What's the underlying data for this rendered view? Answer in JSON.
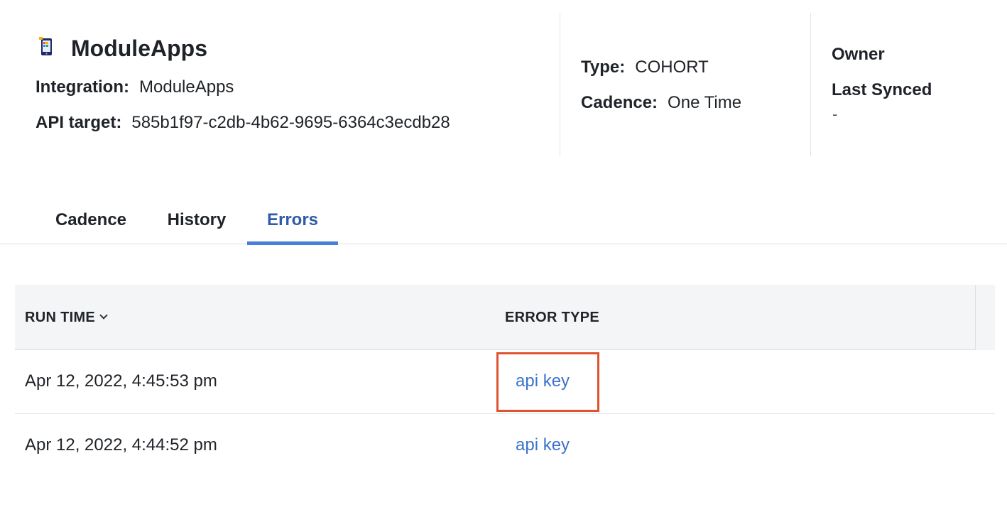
{
  "header": {
    "app_name": "ModuleApps",
    "app_icon": "phone-app-icon",
    "integration_label": "Integration:",
    "integration_value": "ModuleApps",
    "api_target_label": "API target:",
    "api_target_value": "585b1f97-c2db-4b62-9695-6364c3ecdb28",
    "type_label": "Type:",
    "type_value": "COHORT",
    "cadence_label": "Cadence:",
    "cadence_value": "One Time",
    "owner_label": "Owner",
    "last_synced_label": "Last Synced",
    "last_synced_value": "-"
  },
  "tabs": [
    {
      "label": "Cadence",
      "active": false
    },
    {
      "label": "History",
      "active": false
    },
    {
      "label": "Errors",
      "active": true
    }
  ],
  "table": {
    "columns": [
      {
        "label": "RUN TIME",
        "sort_icon": "chevron-down-icon"
      },
      {
        "label": "ERROR TYPE"
      }
    ],
    "rows": [
      {
        "run_time": "Apr 12, 2022, 4:45:53 pm",
        "error_type": "api key",
        "highlighted": true
      },
      {
        "run_time": "Apr 12, 2022, 4:44:52 pm",
        "error_type": "api key",
        "highlighted": false
      }
    ]
  },
  "colors": {
    "active_tab_text": "#2f5ba8",
    "active_tab_underline": "#4a7fd6",
    "link": "#3b72cf",
    "highlight_box": "#e0532f",
    "table_header_bg": "#f4f5f7"
  }
}
